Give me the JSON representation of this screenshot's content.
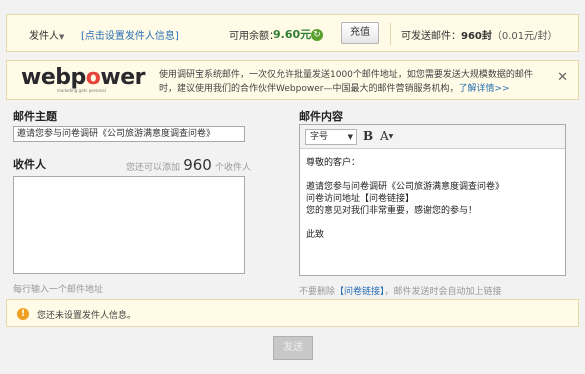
{
  "topbar": {
    "sender_label": "发件人",
    "sender_link": "[点击设置发件人信息]",
    "balance_label": "可用余额：",
    "balance_value": "9.60元",
    "recharge_button": "充值",
    "sendable_label": "可发送邮件：",
    "sendable_value": "960封",
    "rate": "（0.01元/封）"
  },
  "banner": {
    "logo_text_web": "webp",
    "logo_text_o": "o",
    "logo_text_rest": "wer",
    "logo_tagline": "marketing gets personal",
    "message": "使用调研宝系统邮件，一次仅允许批量发送1000个邮件地址，如您需要发送大规模数据的邮件时，建议使用我们的合作伙伴Webpower—中国最大的邮件营销服务机构，",
    "more_link": "了解详情>>",
    "close": "✕"
  },
  "subject": {
    "label": "邮件主题",
    "value": "邀请您参与问卷调研《公司旅游满意度调查问卷》"
  },
  "recipients": {
    "label": "收件人",
    "hint_prefix": "您还可以添加",
    "count": "960",
    "hint_suffix": "个收件人",
    "footer_hint": "每行输入一个邮件地址"
  },
  "content": {
    "label": "邮件内容",
    "font_select": "字号",
    "bold_btn": "B",
    "color_btn": "A",
    "lines": [
      "尊敬的客户：",
      "",
      "邀请您参与问卷调研《公司旅游满意度调查问卷》",
      "问卷访问地址【问卷链接】",
      "您的意见对我们非常重要，感谢您的参与！",
      "",
      "此致"
    ],
    "footer_prefix": "不要删除",
    "footer_link": "【问卷链接】",
    "footer_suffix": "，邮件发送时会自动加上链接"
  },
  "warning": {
    "icon": "!",
    "text": "您还未设置发件人信息。"
  },
  "send_button": "发送"
}
